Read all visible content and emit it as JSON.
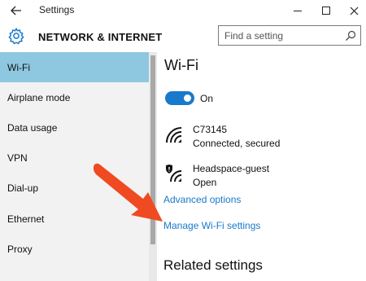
{
  "window": {
    "title": "Settings",
    "back_icon": "back-arrow-icon",
    "minimize_icon": "minimize-icon",
    "maximize_icon": "maximize-icon",
    "close_icon": "close-icon"
  },
  "header": {
    "icon": "gear-icon",
    "title": "NETWORK & INTERNET",
    "search_placeholder": "Find a setting",
    "search_value": "",
    "search_icon": "search-icon"
  },
  "sidebar": {
    "items": [
      {
        "label": "Wi-Fi",
        "active": true
      },
      {
        "label": "Airplane mode",
        "active": false
      },
      {
        "label": "Data usage",
        "active": false
      },
      {
        "label": "VPN",
        "active": false
      },
      {
        "label": "Dial-up",
        "active": false
      },
      {
        "label": "Ethernet",
        "active": false
      },
      {
        "label": "Proxy",
        "active": false
      }
    ]
  },
  "main": {
    "title": "Wi-Fi",
    "toggle": {
      "state": "On",
      "on": true
    },
    "networks": [
      {
        "name": "C73145",
        "status": "Connected, secured",
        "icon": "wifi-signal-icon"
      },
      {
        "name": "Headspace-guest",
        "status": "Open",
        "icon": "wifi-shield-icon"
      }
    ],
    "links": {
      "advanced": "Advanced options",
      "manage": "Manage Wi-Fi settings"
    },
    "related_title": "Related settings"
  },
  "annotation": {
    "icon": "red-arrow-icon",
    "color": "#f04a23"
  },
  "colors": {
    "accent": "#1979ca",
    "sidebar_bg": "#f2f2f2",
    "active_item": "#8dc8e0"
  }
}
